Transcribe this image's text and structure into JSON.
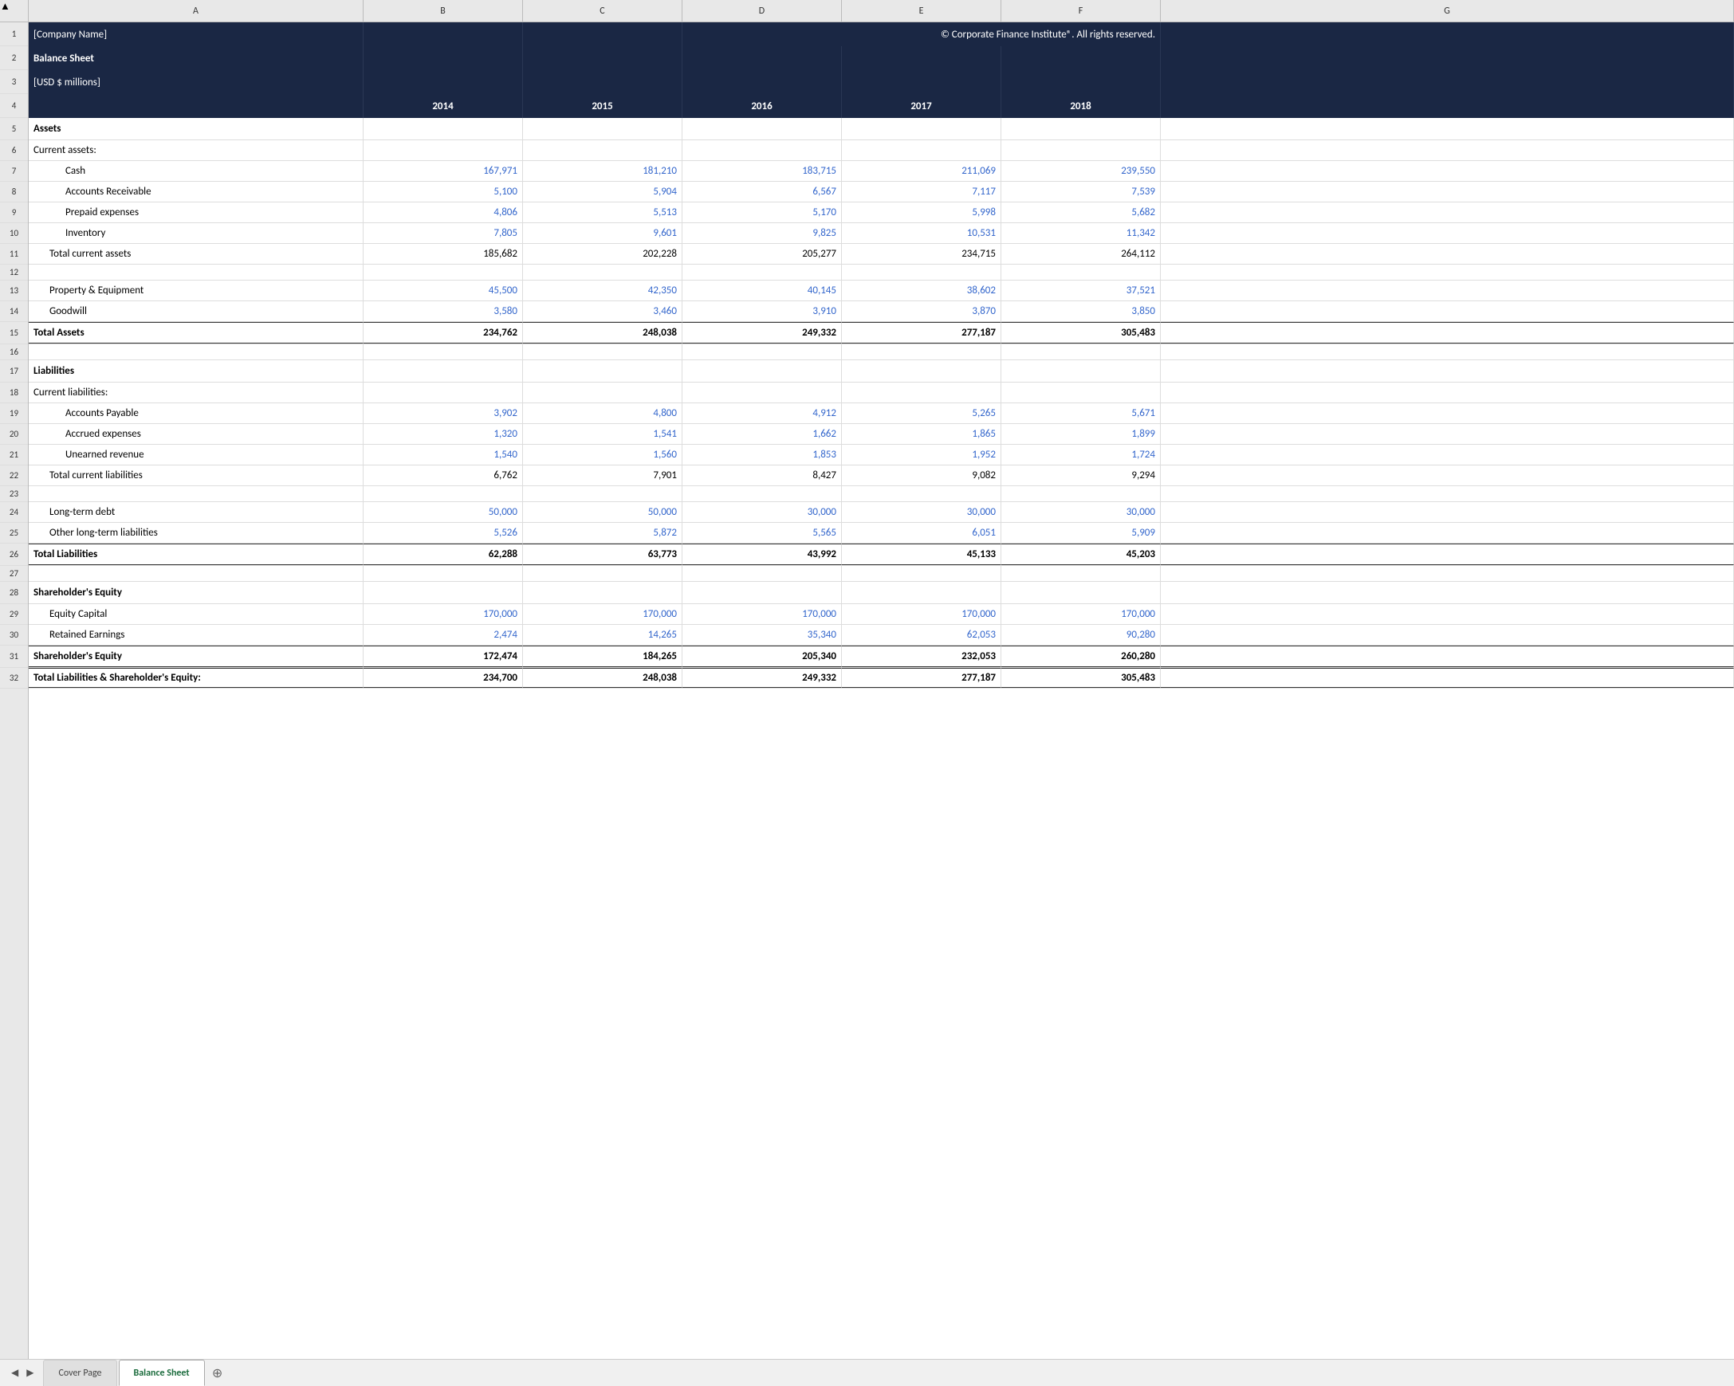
{
  "columns": {
    "headers": [
      "A",
      "B",
      "C",
      "D",
      "E",
      "F",
      "G"
    ],
    "corner": "▲"
  },
  "header": {
    "company_name": "[Company Name]",
    "copyright": "© Corporate Finance Institute®. All rights reserved.",
    "sheet_title": "Balance Sheet",
    "currency": "[USD $ millions]",
    "years": [
      "2014",
      "2015",
      "2016",
      "2017",
      "2018"
    ]
  },
  "rows": [
    {
      "num": "1",
      "a": "[Company Name]",
      "b": "",
      "c": "",
      "d": "© Corporate Finance Institute®. All rights reserved.",
      "e": "",
      "f": "",
      "type": "dark",
      "colspan_d": true
    },
    {
      "num": "2",
      "a": "Balance Sheet",
      "type": "dark"
    },
    {
      "num": "3",
      "a": "[USD $ millions]",
      "type": "dark"
    },
    {
      "num": "4",
      "a": "",
      "b": "2014",
      "c": "2015",
      "d": "2016",
      "e": "2017",
      "f": "2018",
      "type": "years"
    },
    {
      "num": "5",
      "a": "Assets",
      "type": "section-header"
    },
    {
      "num": "6",
      "a": "Current assets:",
      "type": "normal"
    },
    {
      "num": "7",
      "a": "Cash",
      "b": "167,971",
      "c": "181,210",
      "d": "183,715",
      "e": "211,069",
      "f": "239,550",
      "type": "data-blue",
      "indent": 2
    },
    {
      "num": "8",
      "a": "Accounts Receivable",
      "b": "5,100",
      "c": "5,904",
      "d": "6,567",
      "e": "7,117",
      "f": "7,539",
      "type": "data-blue",
      "indent": 2
    },
    {
      "num": "9",
      "a": "Prepaid expenses",
      "b": "4,806",
      "c": "5,513",
      "d": "5,170",
      "e": "5,998",
      "f": "5,682",
      "type": "data-blue",
      "indent": 2
    },
    {
      "num": "10",
      "a": "Inventory",
      "b": "7,805",
      "c": "9,601",
      "d": "9,825",
      "e": "10,531",
      "f": "11,342",
      "type": "data-blue",
      "indent": 2
    },
    {
      "num": "11",
      "a": "Total current assets",
      "b": "185,682",
      "c": "202,228",
      "d": "205,277",
      "e": "234,715",
      "f": "264,112",
      "type": "total-normal",
      "indent": 1
    },
    {
      "num": "12",
      "a": "",
      "type": "empty"
    },
    {
      "num": "13",
      "a": "Property & Equipment",
      "b": "45,500",
      "c": "42,350",
      "d": "40,145",
      "e": "38,602",
      "f": "37,521",
      "type": "data-blue",
      "indent": 1
    },
    {
      "num": "14",
      "a": "Goodwill",
      "b": "3,580",
      "c": "3,460",
      "d": "3,910",
      "e": "3,870",
      "f": "3,850",
      "type": "data-blue",
      "indent": 1
    },
    {
      "num": "15",
      "a": "Total Assets",
      "b": "234,762",
      "c": "248,038",
      "d": "249,332",
      "e": "277,187",
      "f": "305,483",
      "type": "total-bold"
    },
    {
      "num": "16",
      "a": "",
      "type": "empty"
    },
    {
      "num": "17",
      "a": "Liabilities",
      "type": "section-header"
    },
    {
      "num": "18",
      "a": "Current liabilities:",
      "type": "normal"
    },
    {
      "num": "19",
      "a": "Accounts Payable",
      "b": "3,902",
      "c": "4,800",
      "d": "4,912",
      "e": "5,265",
      "f": "5,671",
      "type": "data-blue",
      "indent": 2
    },
    {
      "num": "20",
      "a": "Accrued expenses",
      "b": "1,320",
      "c": "1,541",
      "d": "1,662",
      "e": "1,865",
      "f": "1,899",
      "type": "data-blue",
      "indent": 2
    },
    {
      "num": "21",
      "a": "Unearned revenue",
      "b": "1,540",
      "c": "1,560",
      "d": "1,853",
      "e": "1,952",
      "f": "1,724",
      "type": "data-blue",
      "indent": 2
    },
    {
      "num": "22",
      "a": "Total current liabilities",
      "b": "6,762",
      "c": "7,901",
      "d": "8,427",
      "e": "9,082",
      "f": "9,294",
      "type": "total-normal",
      "indent": 1
    },
    {
      "num": "23",
      "a": "",
      "type": "empty"
    },
    {
      "num": "24",
      "a": "Long-term debt",
      "b": "50,000",
      "c": "50,000",
      "d": "30,000",
      "e": "30,000",
      "f": "30,000",
      "type": "data-blue",
      "indent": 1
    },
    {
      "num": "25",
      "a": "Other long-term liabilities",
      "b": "5,526",
      "c": "5,872",
      "d": "5,565",
      "e": "6,051",
      "f": "5,909",
      "type": "data-blue",
      "indent": 1
    },
    {
      "num": "26",
      "a": "Total Liabilities",
      "b": "62,288",
      "c": "63,773",
      "d": "43,992",
      "e": "45,133",
      "f": "45,203",
      "type": "total-bold"
    },
    {
      "num": "27",
      "a": "",
      "type": "empty"
    },
    {
      "num": "28",
      "a": "Shareholder's Equity",
      "type": "section-header-bold"
    },
    {
      "num": "29",
      "a": "Equity Capital",
      "b": "170,000",
      "c": "170,000",
      "d": "170,000",
      "e": "170,000",
      "f": "170,000",
      "type": "data-blue",
      "indent": 1
    },
    {
      "num": "30",
      "a": "Retained Earnings",
      "b": "2,474",
      "c": "14,265",
      "d": "35,340",
      "e": "62,053",
      "f": "90,280",
      "type": "data-blue",
      "indent": 1
    },
    {
      "num": "31",
      "a": "Shareholder's Equity",
      "b": "172,474",
      "c": "184,265",
      "d": "205,340",
      "e": "232,053",
      "f": "260,280",
      "type": "total-bold"
    },
    {
      "num": "32",
      "a": "Total Liabilities & Shareholder's Equity:",
      "b": "234,700",
      "c": "248,038",
      "d": "249,332",
      "e": "277,187",
      "f": "305,483",
      "type": "total-bold-partial"
    }
  ],
  "tabs": [
    {
      "name": "Cover Page",
      "active": false
    },
    {
      "name": "Balance Sheet",
      "active": true
    }
  ],
  "colors": {
    "dark_bg": "#1a2744",
    "blue_text": "#3366cc",
    "grid_border": "#dddddd"
  }
}
